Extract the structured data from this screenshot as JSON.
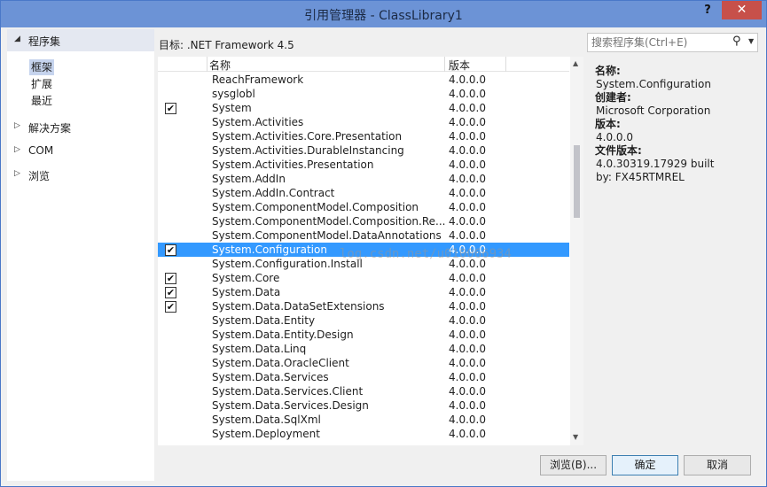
{
  "window": {
    "title": "引用管理器 - ClassLibrary1",
    "help_label": "?",
    "close_label": "✕"
  },
  "nav": {
    "header": "程序集",
    "sub_items": [
      "框架",
      "扩展",
      "最近"
    ],
    "items": [
      "解决方案",
      "COM",
      "浏览"
    ]
  },
  "target": "目标: .NET Framework 4.5",
  "search": {
    "placeholder": "搜索程序集(Ctrl+E)"
  },
  "list": {
    "columns": [
      "名称",
      "版本"
    ],
    "rows": [
      {
        "name": "ReachFramework",
        "version": "4.0.0.0",
        "checked": false
      },
      {
        "name": "sysglobl",
        "version": "4.0.0.0",
        "checked": false
      },
      {
        "name": "System",
        "version": "4.0.0.0",
        "checked": true
      },
      {
        "name": "System.Activities",
        "version": "4.0.0.0",
        "checked": false
      },
      {
        "name": "System.Activities.Core.Presentation",
        "version": "4.0.0.0",
        "checked": false
      },
      {
        "name": "System.Activities.DurableInstancing",
        "version": "4.0.0.0",
        "checked": false
      },
      {
        "name": "System.Activities.Presentation",
        "version": "4.0.0.0",
        "checked": false
      },
      {
        "name": "System.AddIn",
        "version": "4.0.0.0",
        "checked": false
      },
      {
        "name": "System.AddIn.Contract",
        "version": "4.0.0.0",
        "checked": false
      },
      {
        "name": "System.ComponentModel.Composition",
        "version": "4.0.0.0",
        "checked": false
      },
      {
        "name": "System.ComponentModel.Composition.Re...",
        "version": "4.0.0.0",
        "checked": false
      },
      {
        "name": "System.ComponentModel.DataAnnotations",
        "version": "4.0.0.0",
        "checked": false
      },
      {
        "name": "System.Configuration",
        "version": "4.0.0.0",
        "checked": true,
        "selected": true
      },
      {
        "name": "System.Configuration.Install",
        "version": "4.0.0.0",
        "checked": false
      },
      {
        "name": "System.Core",
        "version": "4.0.0.0",
        "checked": true
      },
      {
        "name": "System.Data",
        "version": "4.0.0.0",
        "checked": true
      },
      {
        "name": "System.Data.DataSetExtensions",
        "version": "4.0.0.0",
        "checked": true
      },
      {
        "name": "System.Data.Entity",
        "version": "4.0.0.0",
        "checked": false
      },
      {
        "name": "System.Data.Entity.Design",
        "version": "4.0.0.0",
        "checked": false
      },
      {
        "name": "System.Data.Linq",
        "version": "4.0.0.0",
        "checked": false
      },
      {
        "name": "System.Data.OracleClient",
        "version": "4.0.0.0",
        "checked": false
      },
      {
        "name": "System.Data.Services",
        "version": "4.0.0.0",
        "checked": false
      },
      {
        "name": "System.Data.Services.Client",
        "version": "4.0.0.0",
        "checked": false
      },
      {
        "name": "System.Data.Services.Design",
        "version": "4.0.0.0",
        "checked": false
      },
      {
        "name": "System.Data.SqlXml",
        "version": "4.0.0.0",
        "checked": false
      },
      {
        "name": "System.Deployment",
        "version": "4.0.0.0",
        "checked": false
      }
    ]
  },
  "details": {
    "name_label": "名称:",
    "name_value": "System.Configuration",
    "creator_label": "创建者:",
    "creator_value": "Microsoft Corporation",
    "version_label": "版本:",
    "version_value": "4.0.0.0",
    "file_version_label": "文件版本:",
    "file_version_value": "4.0.30319.17929 built by: FX45RTMREL"
  },
  "watermark": "log.csdn.net/u010066934",
  "buttons": {
    "browse": "浏览(B)...",
    "ok": "确定",
    "cancel": "取消"
  },
  "colors": {
    "selection": "#3399ff",
    "title_bar": "#6c93d6",
    "close": "#c7504a"
  }
}
